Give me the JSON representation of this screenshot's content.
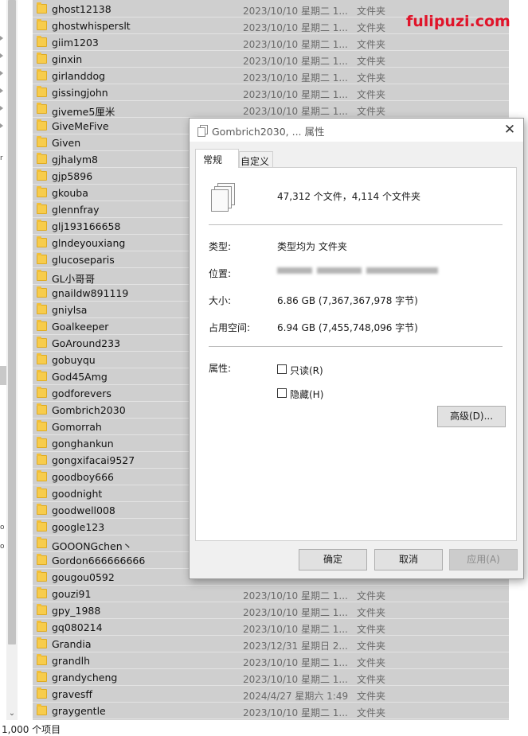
{
  "watermark": "fulipuzi.com",
  "nav_fragments": [
    "r",
    "o",
    "o"
  ],
  "file_list": {
    "items": [
      {
        "name": "ghost12138",
        "date": "2023/10/10 星期二 1...",
        "type": "文件夹"
      },
      {
        "name": "ghostwhisperslt",
        "date": "2023/10/10 星期二 1...",
        "type": "文件夹"
      },
      {
        "name": "giim1203",
        "date": "2023/10/10 星期二 1...",
        "type": "文件夹"
      },
      {
        "name": "ginxin",
        "date": "2023/10/10 星期二 1...",
        "type": "文件夹"
      },
      {
        "name": "girlanddog",
        "date": "2023/10/10 星期二 1...",
        "type": "文件夹"
      },
      {
        "name": "gissingjohn",
        "date": "2023/10/10 星期二 1...",
        "type": "文件夹"
      },
      {
        "name": "giveme5厘米",
        "date": "2023/10/10 星期二 1...",
        "type": "文件夹"
      },
      {
        "name": "GiveMeFive",
        "date": "",
        "type": ""
      },
      {
        "name": "Given",
        "date": "",
        "type": ""
      },
      {
        "name": "gjhalym8",
        "date": "",
        "type": ""
      },
      {
        "name": "gjp5896",
        "date": "",
        "type": ""
      },
      {
        "name": "gkouba",
        "date": "",
        "type": ""
      },
      {
        "name": "glennfray",
        "date": "",
        "type": ""
      },
      {
        "name": "glj193166658",
        "date": "",
        "type": ""
      },
      {
        "name": "glndeyouxiang",
        "date": "",
        "type": ""
      },
      {
        "name": "glucoseparis",
        "date": "",
        "type": ""
      },
      {
        "name": "GL小哥哥",
        "date": "",
        "type": ""
      },
      {
        "name": "gnaildw891119",
        "date": "",
        "type": ""
      },
      {
        "name": "gniylsa",
        "date": "",
        "type": ""
      },
      {
        "name": "Goalkeeper",
        "date": "",
        "type": ""
      },
      {
        "name": "GoAround233",
        "date": "",
        "type": ""
      },
      {
        "name": "gobuyqu",
        "date": "",
        "type": ""
      },
      {
        "name": "God45Amg",
        "date": "",
        "type": ""
      },
      {
        "name": "godforevers",
        "date": "",
        "type": ""
      },
      {
        "name": "Gombrich2030",
        "date": "",
        "type": ""
      },
      {
        "name": "Gomorrah",
        "date": "",
        "type": ""
      },
      {
        "name": "gonghankun",
        "date": "",
        "type": ""
      },
      {
        "name": "gongxifacai9527",
        "date": "",
        "type": ""
      },
      {
        "name": "goodboy666",
        "date": "",
        "type": ""
      },
      {
        "name": "goodnight",
        "date": "",
        "type": ""
      },
      {
        "name": "goodwell008",
        "date": "",
        "type": ""
      },
      {
        "name": "google123",
        "date": "",
        "type": ""
      },
      {
        "name": "GOOONGchen丶",
        "date": "",
        "type": ""
      },
      {
        "name": "Gordon666666666",
        "date": "",
        "type": ""
      },
      {
        "name": "gougou0592",
        "date": "",
        "type": ""
      },
      {
        "name": "gouzi91",
        "date": "2023/10/10 星期二 1...",
        "type": "文件夹"
      },
      {
        "name": "gpy_1988",
        "date": "2023/10/10 星期二 1...",
        "type": "文件夹"
      },
      {
        "name": "gq080214",
        "date": "2023/10/10 星期二 1...",
        "type": "文件夹"
      },
      {
        "name": "Grandia",
        "date": "2023/12/31 星期日 2...",
        "type": "文件夹"
      },
      {
        "name": "grandlh",
        "date": "2023/10/10 星期二 1...",
        "type": "文件夹"
      },
      {
        "name": "grandycheng",
        "date": "2023/10/10 星期二 1...",
        "type": "文件夹"
      },
      {
        "name": "gravesff",
        "date": "2024/4/27 星期六 1:49",
        "type": "文件夹"
      },
      {
        "name": "graygentle",
        "date": "2023/10/10 星期二 1...",
        "type": "文件夹"
      }
    ]
  },
  "status_bar": {
    "text": "1,000 个项目"
  },
  "dialog": {
    "title": "Gombrich2030, ... 属性",
    "close_glyph": "✕",
    "tabs": [
      "常规",
      "自定义"
    ],
    "summary": "47,312 个文件，4,114 个文件夹",
    "rows": [
      {
        "label": "类型:",
        "value": "类型均为 文件夹"
      },
      {
        "label": "位置:",
        "value": ""
      },
      {
        "label": "大小:",
        "value": "6.86 GB (7,367,367,978 字节)"
      },
      {
        "label": "占用空间:",
        "value": "6.94 GB (7,455,748,096 字节)"
      }
    ],
    "attributes_label": "属性:",
    "readonly_label": "只读(R)",
    "hidden_label": "隐藏(H)",
    "advanced_label": "高级(D)...",
    "buttons": {
      "ok": "确定",
      "cancel": "取消",
      "apply": "应用(A)"
    }
  },
  "colors": {
    "list_background": "#cfcfcf",
    "folder_icon": "#f7cc4c",
    "watermark": "#e0142a",
    "dialog_background": "#f0f0f0"
  },
  "icons": {
    "folder": "folder-icon",
    "dialog": "properties-icon",
    "close": "close-icon",
    "scroll_down": "chevron-down-icon"
  }
}
